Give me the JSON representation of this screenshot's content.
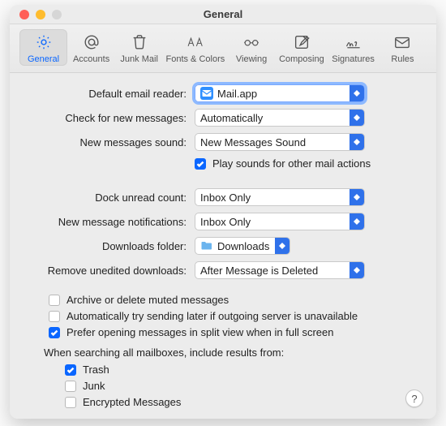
{
  "title": "General",
  "tabs": [
    {
      "id": "general",
      "label": "General"
    },
    {
      "id": "accounts",
      "label": "Accounts"
    },
    {
      "id": "junkmail",
      "label": "Junk Mail"
    },
    {
      "id": "fonts",
      "label": "Fonts & Colors"
    },
    {
      "id": "viewing",
      "label": "Viewing"
    },
    {
      "id": "composing",
      "label": "Composing"
    },
    {
      "id": "signatures",
      "label": "Signatures"
    },
    {
      "id": "rules",
      "label": "Rules"
    }
  ],
  "labels": {
    "defaultReader": "Default email reader:",
    "checkNew": "Check for new messages:",
    "newSound": "New messages sound:",
    "playSounds": "Play sounds for other mail actions",
    "dockCount": "Dock unread count:",
    "notifications": "New message notifications:",
    "downloadsFolder": "Downloads folder:",
    "removeDownloads": "Remove unedited downloads:",
    "archiveMuted": "Archive or delete muted messages",
    "autoRetry": "Automatically try sending later if outgoing server is unavailable",
    "splitView": "Prefer opening messages in split view when in full screen",
    "searchHeader": "When searching all mailboxes, include results from:",
    "trash": "Trash",
    "junk": "Junk",
    "encrypted": "Encrypted Messages"
  },
  "values": {
    "defaultReader": "Mail.app",
    "checkNew": "Automatically",
    "newSound": "New Messages Sound",
    "dockCount": "Inbox Only",
    "notifications": "Inbox Only",
    "downloadsFolder": "Downloads",
    "removeDownloads": "After Message is Deleted"
  },
  "checkboxes": {
    "playSounds": true,
    "archiveMuted": false,
    "autoRetry": false,
    "splitView": true,
    "trash": true,
    "junk": false,
    "encrypted": false
  },
  "help": "?"
}
